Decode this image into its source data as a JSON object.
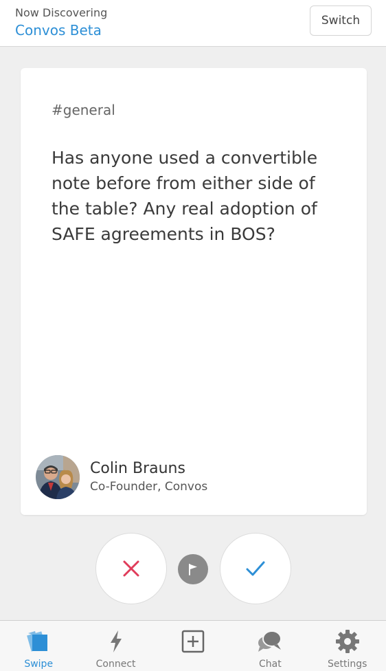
{
  "header": {
    "subtitle": "Now Discovering",
    "title": "Convos Beta",
    "switch_label": "Switch"
  },
  "card": {
    "channel": "#general",
    "question": "Has anyone used a convertible note before from either side of the table? Any real adoption of SAFE agreements in BOS?",
    "author_name": "Colin Brauns",
    "author_role": "Co-Founder, Convos"
  },
  "actions": {
    "reject_icon": "close-icon",
    "flag_icon": "flag-icon",
    "accept_icon": "check-icon"
  },
  "tabs": [
    {
      "label": "Swipe",
      "icon": "cards-icon",
      "active": true
    },
    {
      "label": "Connect",
      "icon": "bolt-icon",
      "active": false
    },
    {
      "label": "",
      "icon": "plus-square-icon",
      "active": false
    },
    {
      "label": "Chat",
      "icon": "chat-bubbles-icon",
      "active": false
    },
    {
      "label": "Settings",
      "icon": "gear-icon",
      "active": false
    }
  ],
  "colors": {
    "accent": "#2d8fd6",
    "reject": "#e03c5a",
    "flag_bg": "#8a8a8a",
    "background": "#efefef"
  }
}
